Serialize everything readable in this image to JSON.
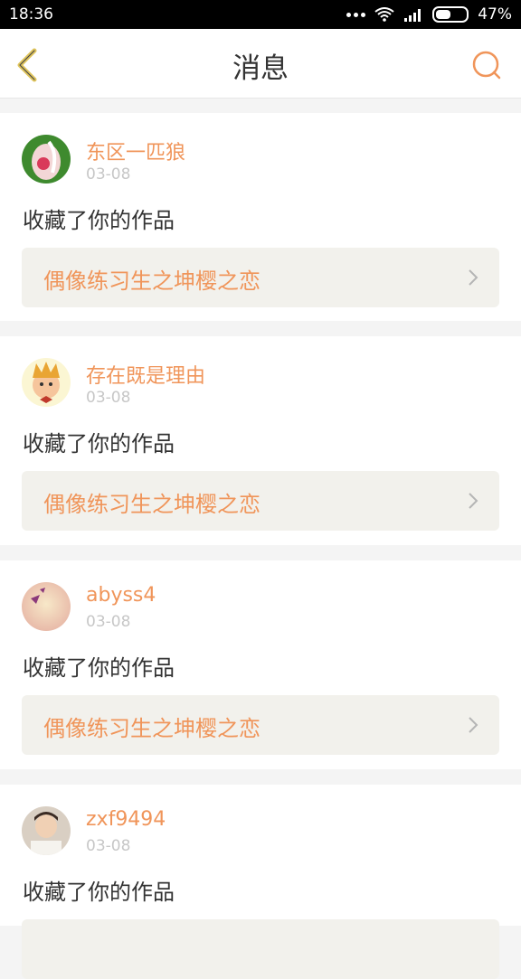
{
  "status_bar": {
    "time": "18:36",
    "battery": "47%"
  },
  "header": {
    "title": "消息"
  },
  "messages": [
    {
      "user": "东区一匹狼",
      "date": "03-08",
      "action": "收藏了你的作品",
      "work_title": "偶像练习生之坤樱之恋"
    },
    {
      "user": "存在既是理由",
      "date": "03-08",
      "action": "收藏了你的作品",
      "work_title": "偶像练习生之坤樱之恋"
    },
    {
      "user": "abyss4",
      "date": "03-08",
      "action": "收藏了你的作品",
      "work_title": "偶像练习生之坤樱之恋"
    },
    {
      "user": "zxf9494",
      "date": "03-08",
      "action": "收藏了你的作品"
    }
  ]
}
